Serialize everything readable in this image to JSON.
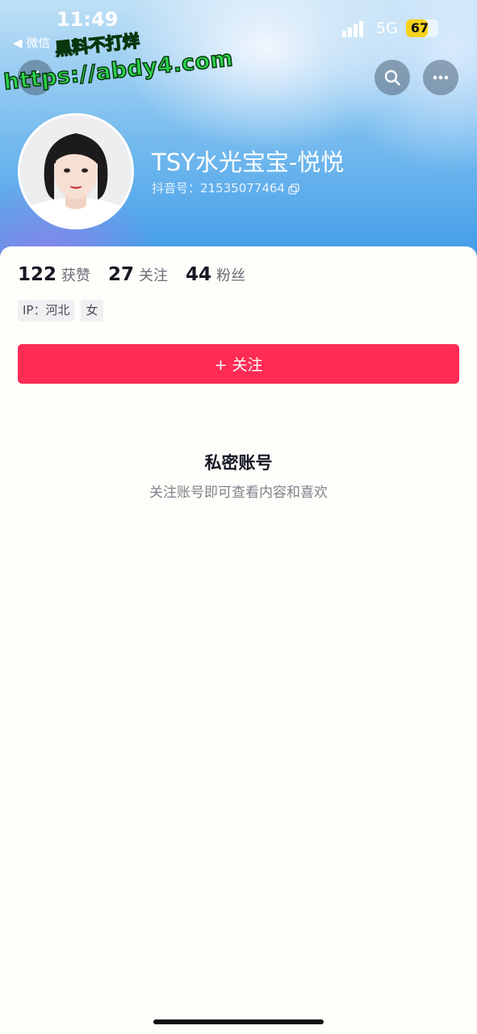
{
  "status_bar": {
    "time": "11:49",
    "back_app": "◀ 微信",
    "network": "5G",
    "battery": "67",
    "battery_level_percent": 67
  },
  "watermark": {
    "line1": "黑料不打烊",
    "line2": "https://abdy4.com"
  },
  "profile": {
    "nickname": "TSY水光宝宝-悦悦",
    "douyin_id": "抖音号：21535077464"
  },
  "stats": [
    {
      "value": "122",
      "label": "获赞"
    },
    {
      "value": "27",
      "label": "关注"
    },
    {
      "value": "44",
      "label": "粉丝"
    }
  ],
  "tags": [
    "IP：河北",
    "女"
  ],
  "follow_button": {
    "label": "+ 关注"
  },
  "private": {
    "title": "私密账号",
    "subtitle": "关注账号即可查看内容和喜欢"
  },
  "colors": {
    "accent": "#fe2c55",
    "watermark": "#2bd34a"
  }
}
